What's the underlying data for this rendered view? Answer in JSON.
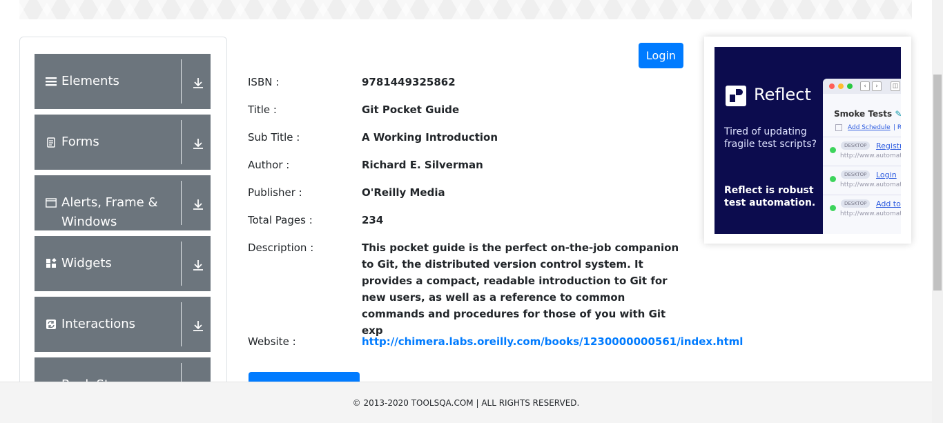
{
  "sidebar": {
    "groups": [
      {
        "label": "Elements",
        "icon": "hamburger-icon"
      },
      {
        "label": "Forms",
        "icon": "document-icon"
      },
      {
        "label": "Alerts, Frame & Windows",
        "icon": "window-icon"
      },
      {
        "label": "Widgets",
        "icon": "widgets-icon"
      },
      {
        "label": "Interactions",
        "icon": "interactions-icon"
      },
      {
        "label": "Book Store Application",
        "icon": "book-icon"
      }
    ]
  },
  "header": {
    "login_label": "Login"
  },
  "book": {
    "fields": [
      {
        "label": "ISBN :",
        "value": "9781449325862"
      },
      {
        "label": "Title :",
        "value": "Git Pocket Guide"
      },
      {
        "label": "Sub Title :",
        "value": "A Working Introduction"
      },
      {
        "label": "Author :",
        "value": "Richard E. Silverman"
      },
      {
        "label": "Publisher :",
        "value": "O'Reilly Media"
      },
      {
        "label": "Total Pages :",
        "value": "234"
      },
      {
        "label": "Description :",
        "value": "This pocket guide is the perfect on-the-job companion to Git, the distributed version control system. It provides a compact, readable introduction to Git for new users, as well as a reference to common commands and procedures for those of you with Git exp"
      },
      {
        "label": "Website :",
        "value": "http://chimera.labs.oreilly.com/books/1230000000561/index.html"
      }
    ]
  },
  "ad": {
    "brand": "Reflect",
    "tagline": "Tired of updating fragile test scripts?",
    "tagline2": "Reflect is robust test automation.",
    "window_title": "Smoke Tests",
    "schedule_link": "Add Schedule",
    "schedule_more": "| Ru",
    "rows": [
      {
        "badge": "DESKTOP",
        "link": "Registr",
        "url": "http://www.automat"
      },
      {
        "badge": "DESKTOP",
        "link": "Login",
        "url": "http://www.automat"
      },
      {
        "badge": "DESKTOP",
        "link": "Add to",
        "url": "http://www.automat"
      }
    ]
  },
  "footer": {
    "text": "© 2013-2020 TOOLSQA.COM | ALL RIGHTS RESERVED."
  },
  "colors": {
    "primary": "#007bff",
    "sidebar_group": "#6c757d",
    "ad_bg": "#0c0c4e"
  }
}
